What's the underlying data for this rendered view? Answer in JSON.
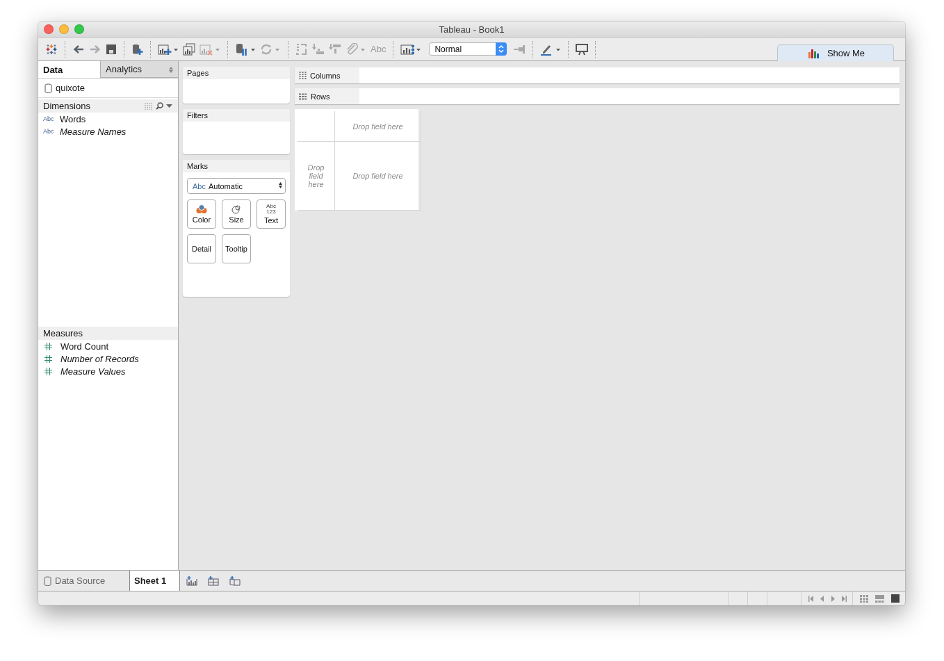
{
  "window": {
    "title": "Tableau - Book1"
  },
  "toolbar": {
    "labels_button": {
      "label": "Abc",
      "disabled": true
    },
    "view_size": "Normal",
    "show_me": "Show Me"
  },
  "side_tabs": [
    {
      "label": "Data",
      "selected": true
    },
    {
      "label": "Analytics",
      "selected": false
    }
  ],
  "data_source": "quixote",
  "dimensions": {
    "title": "Dimensions",
    "fields": [
      {
        "type_label": "Abc",
        "name": "Words",
        "generated": false
      },
      {
        "type_label": "Abc",
        "name": "Measure Names",
        "generated": true
      }
    ]
  },
  "measures": {
    "title": "Measures",
    "fields": [
      {
        "name": "Word Count",
        "generated": false
      },
      {
        "name": "Number of Records",
        "generated": true
      },
      {
        "name": "Measure Values",
        "generated": true
      }
    ]
  },
  "shelves": {
    "pages": "Pages",
    "filters": "Filters",
    "columns": "Columns",
    "rows": "Rows"
  },
  "marks": {
    "title": "Marks",
    "mark_type_label": "Abc",
    "mark_type": "Automatic",
    "buttons": [
      {
        "label": "Color",
        "kind": "color"
      },
      {
        "label": "Size",
        "kind": "size"
      },
      {
        "label": "Text",
        "kind": "text",
        "icon_lines": [
          "Abc",
          "123"
        ]
      },
      {
        "label": "Detail",
        "kind": "detail"
      },
      {
        "label": "Tooltip",
        "kind": "tooltip"
      }
    ]
  },
  "view": {
    "drop_columns": "Drop field here",
    "drop_rows": "Drop field here",
    "drop_center": "Drop field here"
  },
  "sheet_tabs": [
    {
      "label": "Data Source",
      "kind": "data_source",
      "selected": false
    },
    {
      "label": "Sheet 1",
      "kind": "sheet",
      "selected": true
    }
  ]
}
